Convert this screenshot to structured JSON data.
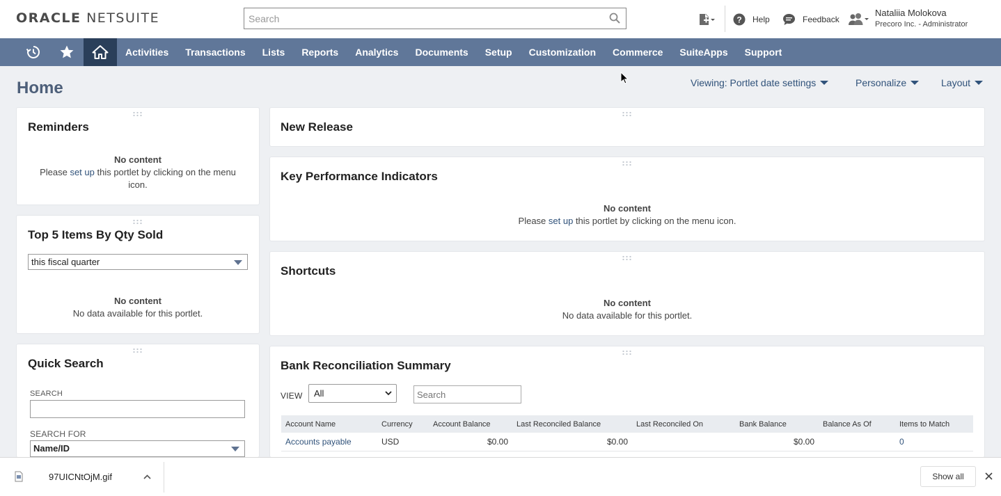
{
  "header": {
    "logo_left": "ORACLE",
    "logo_right": "NETSUITE",
    "search_placeholder": "Search",
    "help_label": "Help",
    "feedback_label": "Feedback",
    "user_name": "Nataliia Molokova",
    "user_role": "Precoro Inc. - Administrator"
  },
  "nav": {
    "items": [
      "Activities",
      "Transactions",
      "Lists",
      "Reports",
      "Analytics",
      "Documents",
      "Setup",
      "Customization",
      "Commerce",
      "SuiteApps",
      "Support"
    ]
  },
  "page": {
    "title": "Home",
    "viewing_label": "Viewing: Portlet date settings",
    "personalize_label": "Personalize",
    "layout_label": "Layout"
  },
  "portlets": {
    "reminders": {
      "title": "Reminders",
      "no_content": "No content",
      "msg_before": "Please ",
      "msg_link": "set up",
      "msg_after_line1": " this portlet by clicking on the menu",
      "msg_after_line2": "icon."
    },
    "top5": {
      "title": "Top 5 Items By Qty Sold",
      "period_value": "this fiscal quarter",
      "no_content": "No content",
      "msg": "No data available for this portlet."
    },
    "quick_search": {
      "title": "Quick Search",
      "search_label": "SEARCH",
      "search_value": "",
      "search_for_label": "SEARCH FOR",
      "search_for_value": "Name/ID"
    },
    "new_release": {
      "title": "New Release"
    },
    "kpi": {
      "title": "Key Performance Indicators",
      "no_content": "No content",
      "msg_before": "Please ",
      "msg_link": "set up",
      "msg_after": " this portlet by clicking on the menu icon."
    },
    "shortcuts": {
      "title": "Shortcuts",
      "no_content": "No content",
      "msg": "No data available for this portlet."
    },
    "bank": {
      "title": "Bank Reconciliation Summary",
      "view_label": "VIEW",
      "view_value": "All",
      "search_placeholder": "Search",
      "columns": [
        "Account Name",
        "Currency",
        "Account Balance",
        "Last Reconciled Balance",
        "Last Reconciled On",
        "Bank Balance",
        "Balance As Of",
        "Items to Match"
      ],
      "rows": [
        {
          "account": "Accounts payable",
          "currency": "USD",
          "account_balance": "$0.00",
          "last_reconciled_balance": "$0.00",
          "last_reconciled_on": "",
          "bank_balance": "$0.00",
          "balance_as_of": "",
          "items_to_match": "0"
        }
      ]
    }
  },
  "download_bar": {
    "file_name": "97UICNtOjM.gif",
    "show_all_label": "Show all"
  },
  "colors": {
    "nav_bg": "#607799",
    "nav_active": "#2a3f5a",
    "link": "#30527a",
    "page_bg": "#eef0f3"
  }
}
